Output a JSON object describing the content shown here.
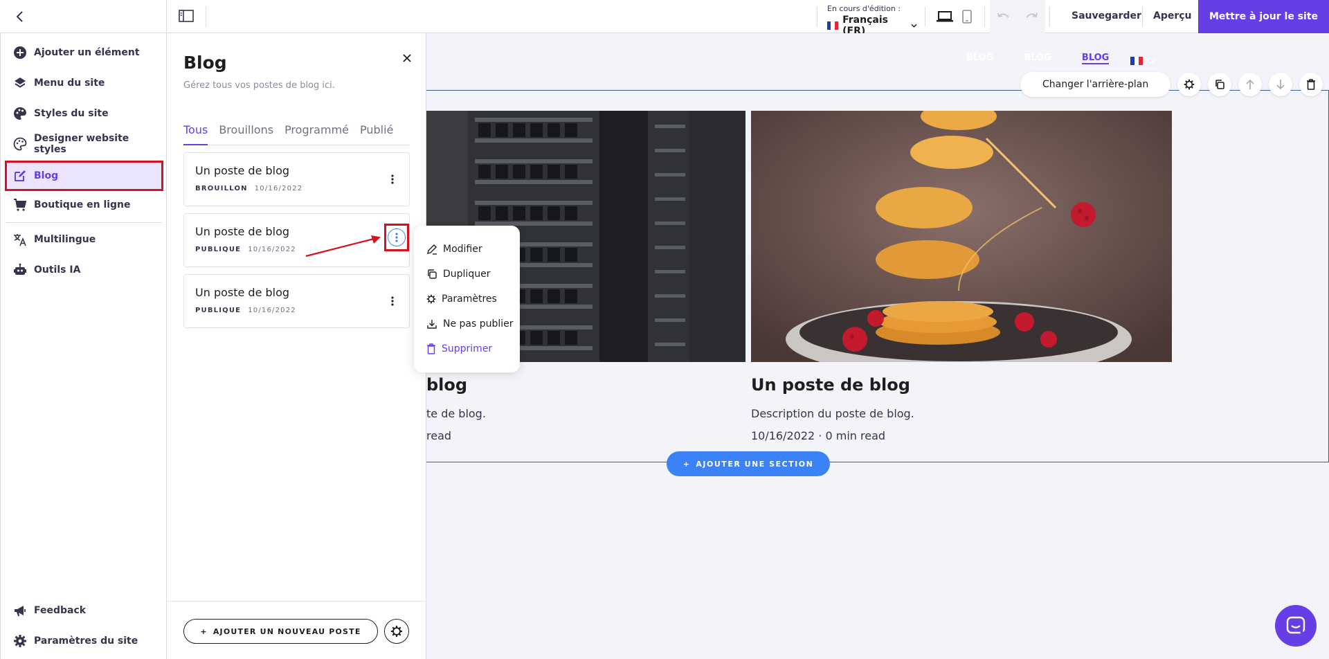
{
  "topbar": {
    "editing_label": "En cours d'édition :",
    "language": "Français (FR)",
    "save_label": "Sauvegarder",
    "preview_label": "Aperçu",
    "publish_label": "Mettre à jour le site"
  },
  "sidebar": {
    "items": [
      {
        "label": "Ajouter un élément",
        "icon": "plus-circle-icon"
      },
      {
        "label": "Menu du site",
        "icon": "layers-icon"
      },
      {
        "label": "Styles du site",
        "icon": "palette-icon"
      },
      {
        "label": "Designer website styles",
        "icon": "palette-outline-icon"
      },
      {
        "label": "Blog",
        "icon": "edit-icon",
        "active": true
      },
      {
        "label": "Boutique en ligne",
        "icon": "cart-icon"
      },
      {
        "label": "Multilingue",
        "icon": "translate-icon"
      },
      {
        "label": "Outils IA",
        "icon": "robot-icon"
      }
    ],
    "footer": [
      {
        "label": "Feedback",
        "icon": "megaphone-icon"
      },
      {
        "label": "Paramètres du site",
        "icon": "gear-icon"
      }
    ]
  },
  "blog_panel": {
    "title": "Blog",
    "description": "Gérez tous vos postes de blog ici.",
    "tabs": [
      "Tous",
      "Brouillons",
      "Programmé",
      "Publié"
    ],
    "posts": [
      {
        "title": "Un poste de blog",
        "status": "BROUILLON",
        "date": "10/16/2022"
      },
      {
        "title": "Un poste de blog",
        "status": "PUBLIQUE",
        "date": "10/16/2022"
      },
      {
        "title": "Un poste de blog",
        "status": "PUBLIQUE",
        "date": "10/16/2022"
      }
    ],
    "add_post_label": "AJOUTER UN NOUVEAU POSTE"
  },
  "context_menu": {
    "items": [
      {
        "label": "Modifier",
        "icon": "pencil-icon"
      },
      {
        "label": "Dupliquer",
        "icon": "copy-icon"
      },
      {
        "label": "Paramètres",
        "icon": "gear-icon"
      },
      {
        "label": "Ne pas publier",
        "icon": "download-icon"
      },
      {
        "label": "Supprimer",
        "icon": "trash-icon"
      }
    ]
  },
  "canvas": {
    "nav": [
      "BLOG",
      "BLOG",
      "BLOG"
    ],
    "change_bg_label": "Changer l'arrière-plan",
    "left_card": {
      "title": "blog",
      "desc": "te de blog.",
      "meta": "read"
    },
    "right_card": {
      "title": "Un poste de blog",
      "desc": "Description du poste de blog.",
      "meta": "10/16/2022 · 0 min read"
    },
    "add_section_label": "AJOUTER UNE SECTION"
  },
  "colors": {
    "accent": "#673de6",
    "highlight": "#d7121f",
    "canvas_blue": "#3b82f6"
  }
}
